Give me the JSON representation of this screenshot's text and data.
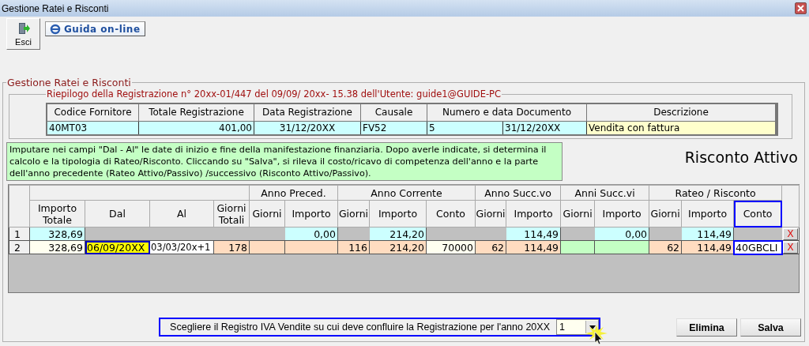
{
  "window": {
    "title": "Gestione Ratei e Risconti"
  },
  "toolbar": [
    {
      "label": "Esci",
      "kind": "exit"
    },
    {
      "label": "Guida on-line",
      "kind": "help"
    }
  ],
  "main_group": {
    "title": "Gestione Ratei e Risconti"
  },
  "summary": {
    "title": "Riepilogo della Registrazione n°  20xx-01/447  del 09/09/ 20xx- 15.38 dell'Utente: guide1@GUIDE-PC",
    "columns": [
      {
        "label": "Codice Fornitore",
        "cells": [
          {
            "text": "40MT03",
            "kind": "text"
          }
        ]
      },
      {
        "label": "Totale Registrazione",
        "cells": [
          {
            "text": "401,00",
            "kind": "number"
          }
        ]
      },
      {
        "label": "Data Registrazione",
        "cells": [
          {
            "text": "31/12/20XX",
            "kind": "center"
          }
        ]
      },
      {
        "label": "Causale",
        "cells": [
          {
            "text": "FV52",
            "kind": "text"
          }
        ]
      },
      {
        "label": "Numero e data Documento",
        "cells": [
          {
            "text": "5",
            "kind": "text"
          },
          {
            "text": "31/12/20XX",
            "kind": "text"
          }
        ]
      },
      {
        "label": "Descrizione",
        "cells": [
          {
            "text": "Vendita con fattura",
            "kind": "note"
          }
        ]
      }
    ]
  },
  "info": "Imputare nei campi \"Dal - Al\" le date di inizio e fine della manifestazione finanziaria. Dopo averle indicate, si determina il calcolo e la tipologia di Rateo/Risconto. Cliccando su \"Salva\", si rileva il costo/ricavo di competenza dell'anno e la parte dell'anno precedente (Rateo Attivo/Passivo) /successivo (Risconto Attivo/Passivo).",
  "result_label": "Risconto Attivo",
  "grid": {
    "column_groups": [
      {
        "columns": [
          {
            "label": "Importo Totale",
            "highlighted": false
          },
          {
            "label": "Dal",
            "highlighted": false
          },
          {
            "label": "Al",
            "highlighted": false
          },
          {
            "label": "Giorni Totali",
            "highlighted": false
          }
        ]
      },
      {
        "label": "Anno Preced.",
        "columns": [
          {
            "label": "Giorni",
            "highlighted": false
          },
          {
            "label": "Importo",
            "highlighted": false
          }
        ]
      },
      {
        "label": "Anno Corrente",
        "columns": [
          {
            "label": "Giorni",
            "highlighted": false
          },
          {
            "label": "Importo",
            "highlighted": false
          },
          {
            "label": "Conto",
            "highlighted": false
          }
        ]
      },
      {
        "label": "Anno Succ.vo",
        "columns": [
          {
            "label": "Giorni",
            "highlighted": false
          },
          {
            "label": "Importo",
            "highlighted": false
          }
        ]
      },
      {
        "label": "Anni Succ.vi",
        "columns": [
          {
            "label": "Giorni",
            "highlighted": false
          },
          {
            "label": "Importo",
            "highlighted": false
          }
        ]
      },
      {
        "label": "Rateo / Risconto",
        "columns": [
          {
            "label": "Giorni",
            "highlighted": false
          },
          {
            "label": "Importo",
            "highlighted": false
          },
          {
            "label": "Conto",
            "highlighted": true
          }
        ]
      }
    ],
    "rows": [
      {
        "number": "1",
        "delete": "X",
        "cells": [
          {
            "text": "328,69",
            "kind": "readonly"
          },
          {
            "kind": "blank"
          },
          {
            "kind": "blank"
          },
          {
            "kind": "blank"
          },
          {
            "kind": "blank"
          },
          {
            "text": "0,00",
            "kind": "readonly"
          },
          {
            "kind": "blank"
          },
          {
            "text": "214,20",
            "kind": "readonly"
          },
          {
            "kind": "blank"
          },
          {
            "kind": "blank"
          },
          {
            "text": "114,49",
            "kind": "readonly"
          },
          {
            "kind": "blank"
          },
          {
            "text": "0,00",
            "kind": "readonly"
          },
          {
            "kind": "blank"
          },
          {
            "text": "114,49",
            "kind": "readonly"
          },
          {
            "kind": "blank"
          }
        ]
      },
      {
        "number": "2",
        "delete": "X",
        "cells": [
          {
            "text": "328,69",
            "kind": "input"
          },
          {
            "text": "06/09/20XX",
            "kind": "focus"
          },
          {
            "text": "03/03/20x+1",
            "kind": "text"
          },
          {
            "text": "178",
            "kind": "calc"
          },
          {
            "kind": "calc"
          },
          {
            "kind": "calc"
          },
          {
            "text": "116",
            "kind": "calc"
          },
          {
            "text": "214,20",
            "kind": "calc"
          },
          {
            "text": "70000",
            "kind": "input"
          },
          {
            "text": "62",
            "kind": "calc"
          },
          {
            "text": "114,49",
            "kind": "calc"
          },
          {
            "kind": "future"
          },
          {
            "kind": "future"
          },
          {
            "text": "62",
            "kind": "calc"
          },
          {
            "text": "114,49",
            "kind": "calc"
          },
          {
            "text": "40GBCLI",
            "kind": "outlined"
          }
        ]
      }
    ]
  },
  "registro": {
    "label": "Scegliere il Registro IVA Vendite su cui deve confluire la Registrazione per l'anno 20XX",
    "value": "1"
  },
  "buttons": [
    "Elimina",
    "Salva"
  ]
}
